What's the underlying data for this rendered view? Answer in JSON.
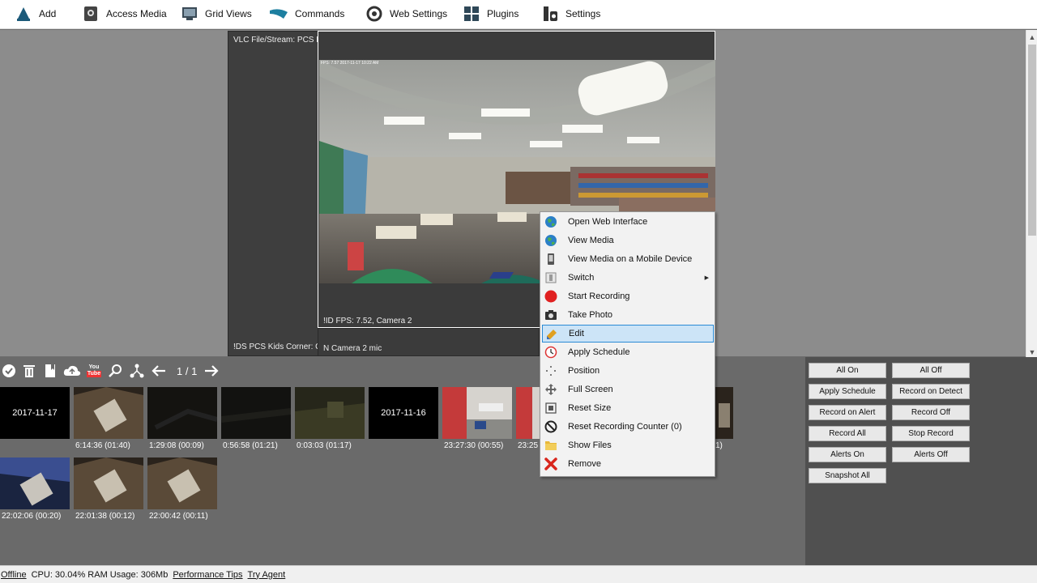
{
  "toolbar": {
    "items": [
      {
        "label": "Add",
        "icon": "add-camera-icon"
      },
      {
        "label": "Access Media",
        "icon": "access-media-icon"
      },
      {
        "label": "Grid Views",
        "icon": "grid-views-icon"
      },
      {
        "label": "Commands",
        "icon": "commands-icon"
      },
      {
        "label": "Web Settings",
        "icon": "web-settings-icon"
      },
      {
        "label": "Plugins",
        "icon": "plugins-icon"
      },
      {
        "label": "Settings",
        "icon": "settings-icon"
      }
    ]
  },
  "tiles": {
    "vlc": {
      "title": "VLC File/Stream: PCS Kid",
      "footer": "!DS  PCS Kids Corner: Of"
    },
    "camera2": {
      "overlay_time": "FPS: 7.57 2017-11-17 10:22 AM",
      "footer": "!ID  FPS: 7.52, Camera 2"
    },
    "mic": {
      "footer": "N  Camera 2 mic"
    }
  },
  "lower_toolbar": {
    "page": "1 / 1",
    "icons": [
      "select-all-icon",
      "delete-icon",
      "bookmark-icon",
      "upload-icon",
      "youtube-icon",
      "search-icon",
      "share-icon",
      "prev-arrow-icon",
      "next-arrow-icon"
    ],
    "youtube_text": "You Tube"
  },
  "thumbnails": {
    "row1": [
      {
        "date": "2017-11-17"
      },
      {
        "label": "6:14:36 (01:40)",
        "tone": "dim-room"
      },
      {
        "label": "1:29:08 (00:09)",
        "tone": "dark"
      },
      {
        "label": "0:56:58 (01:21)",
        "tone": "dark"
      },
      {
        "label": "0:03:03 (01:17)",
        "tone": "dim-olive"
      },
      {
        "date": "2017-11-16"
      },
      {
        "label": "23:27:30 (00:55)",
        "tone": "bright-red"
      },
      {
        "label": "23:25",
        "tone": "bright-red"
      }
    ],
    "row1_partial_label": "1)",
    "row2": [
      {
        "label": "22:02:06 (00:20)",
        "tone": "blue-room"
      },
      {
        "label": "22:01:38 (00:12)",
        "tone": "dim-room"
      },
      {
        "label": "22:00:42 (00:11)",
        "tone": "dim-room"
      }
    ]
  },
  "right_panel": {
    "buttons": [
      "All On",
      "All Off",
      "Apply Schedule",
      "Record on Detect",
      "Record on Alert",
      "Record Off",
      "Record All",
      "Stop Record",
      "Alerts On",
      "Alerts Off",
      "Snapshot All"
    ]
  },
  "context_menu": {
    "items": [
      {
        "label": "Open Web Interface",
        "icon": "globe-icon"
      },
      {
        "label": "View Media",
        "icon": "globe-media-icon"
      },
      {
        "label": "View Media on a Mobile Device",
        "icon": "mobile-icon"
      },
      {
        "label": "Switch",
        "icon": "switch-icon",
        "submenu": true
      },
      {
        "label": "Start Recording",
        "icon": "record-icon"
      },
      {
        "label": "Take Photo",
        "icon": "camera-icon"
      },
      {
        "label": "Edit",
        "icon": "edit-icon",
        "highlighted": true
      },
      {
        "label": "Apply Schedule",
        "icon": "clock-icon"
      },
      {
        "label": "Position",
        "icon": "position-icon"
      },
      {
        "label": "Full Screen",
        "icon": "fullscreen-icon"
      },
      {
        "label": "Reset Size",
        "icon": "reset-size-icon"
      },
      {
        "label": "Reset Recording Counter (0)",
        "icon": "reset-counter-icon"
      },
      {
        "label": "Show Files",
        "icon": "folder-icon"
      },
      {
        "label": "Remove",
        "icon": "remove-icon"
      }
    ],
    "submenu_arrow": "▶"
  },
  "status": {
    "offline": "Offline",
    "usage": "CPU: 30.04% RAM Usage: 306Mb",
    "perf_tips": "Performance Tips",
    "try_agent": "Try Agent"
  },
  "colors": {
    "highlight_bg": "#cce4f7",
    "highlight_border": "#2a8ad4",
    "record_red": "#e02020",
    "remove_red": "#d9261c"
  }
}
